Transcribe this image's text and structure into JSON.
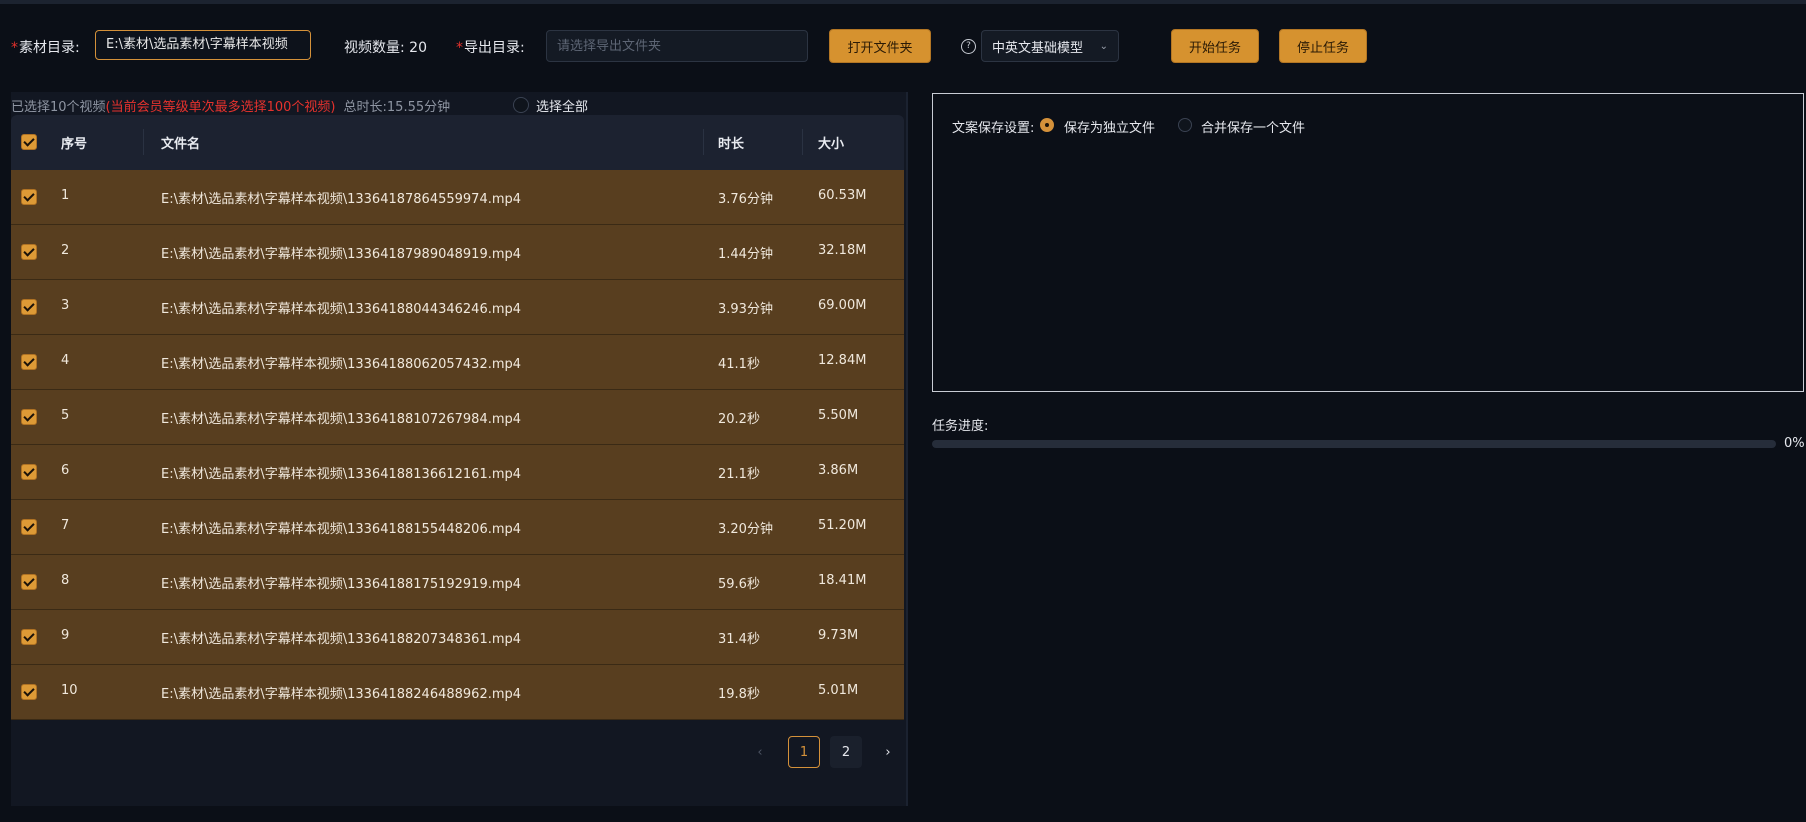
{
  "toolbar": {
    "source_dir_label": "素材目录:",
    "source_dir_value": "E:\\素材\\选品素材\\字幕样本视频",
    "video_count_label": "视频数量:",
    "video_count_value": "20",
    "export_dir_label": "导出目录:",
    "export_dir_placeholder": "请选择导出文件夹",
    "open_folder_label": "打开文件夹",
    "help_icon": "question-circle-icon",
    "model_select_value": "中英文基础模型",
    "start_label": "开始任务",
    "stop_label": "停止任务"
  },
  "selection_info": {
    "selected_text": "已选择10个视频",
    "limit_warning": "(当前会员等级单次最多选择100个视频)",
    "total_duration": "总时长:15.55分钟",
    "select_all_label": "选择全部"
  },
  "table": {
    "headers": [
      "序号",
      "文件名",
      "时长",
      "大小"
    ],
    "rows": [
      {
        "index": "1",
        "filename": "E:\\素材\\选品素材\\字幕样本视频\\13364187864559974.mp4",
        "duration": "3.76分钟",
        "size": "60.53M"
      },
      {
        "index": "2",
        "filename": "E:\\素材\\选品素材\\字幕样本视频\\13364187989048919.mp4",
        "duration": "1.44分钟",
        "size": "32.18M"
      },
      {
        "index": "3",
        "filename": "E:\\素材\\选品素材\\字幕样本视频\\13364188044346246.mp4",
        "duration": "3.93分钟",
        "size": "69.00M"
      },
      {
        "index": "4",
        "filename": "E:\\素材\\选品素材\\字幕样本视频\\13364188062057432.mp4",
        "duration": "41.1秒",
        "size": "12.84M"
      },
      {
        "index": "5",
        "filename": "E:\\素材\\选品素材\\字幕样本视频\\13364188107267984.mp4",
        "duration": "20.2秒",
        "size": "5.50M"
      },
      {
        "index": "6",
        "filename": "E:\\素材\\选品素材\\字幕样本视频\\13364188136612161.mp4",
        "duration": "21.1秒",
        "size": "3.86M"
      },
      {
        "index": "7",
        "filename": "E:\\素材\\选品素材\\字幕样本视频\\13364188155448206.mp4",
        "duration": "3.20分钟",
        "size": "51.20M"
      },
      {
        "index": "8",
        "filename": "E:\\素材\\选品素材\\字幕样本视频\\13364188175192919.mp4",
        "duration": "59.6秒",
        "size": "18.41M"
      },
      {
        "index": "9",
        "filename": "E:\\素材\\选品素材\\字幕样本视频\\13364188207348361.mp4",
        "duration": "31.4秒",
        "size": "9.73M"
      },
      {
        "index": "10",
        "filename": "E:\\素材\\选品素材\\字幕样本视频\\13364188246488962.mp4",
        "duration": "19.8秒",
        "size": "5.01M"
      }
    ]
  },
  "pagination": {
    "prev": "‹",
    "pages": [
      "1",
      "2"
    ],
    "current": "1",
    "next": "›"
  },
  "settings": {
    "save_label": "文案保存设置:",
    "option_separate": "保存为独立文件",
    "option_merge": "合并保存一个文件",
    "selected": "separate"
  },
  "progress": {
    "label": "任务进度:",
    "value": 0,
    "text": "0%"
  },
  "colors": {
    "accent": "#d4913a",
    "row_bg": "#583e1f",
    "warning": "#e5322d",
    "background": "#0b0f17"
  }
}
